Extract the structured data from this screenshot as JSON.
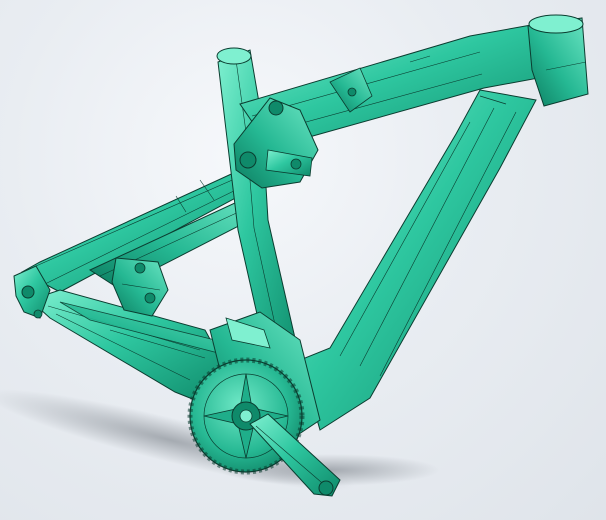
{
  "viewport": {
    "background_top": "#f6f8fb",
    "background_bottom": "#dfe4ea",
    "shadow_color": "#8f959c"
  },
  "model": {
    "body_color": "#2ec7a0",
    "highlight_color": "#7ff0d0",
    "dark_color": "#0f8a6a",
    "edge_color": "#0b3d30"
  },
  "icons": {
    "frame": "bicycle-frame-icon",
    "chainring": "chainring-icon",
    "crank": "crank-arm-icon",
    "caliper": "brake-caliper-icon"
  }
}
